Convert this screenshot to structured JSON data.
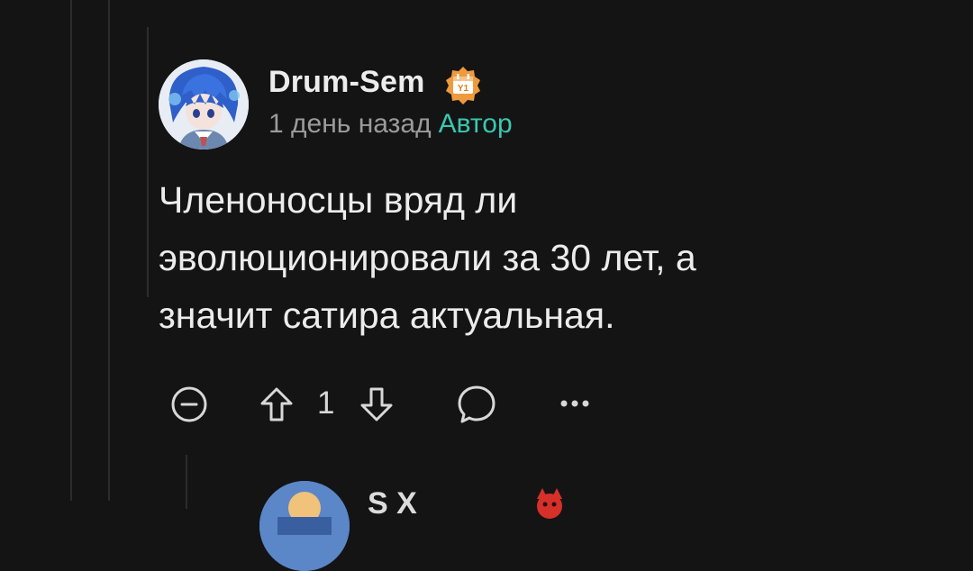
{
  "comment": {
    "author": {
      "name": "Drum-Sem",
      "avatar": "anime-avatar-blue-hair",
      "badge": {
        "icon": "calendar-badge-icon",
        "text": "Y1",
        "color": "#f09a3e"
      }
    },
    "time": "1 день назад",
    "author_tag": "Автор",
    "text_lines": [
      "Членоносцы вряд ли",
      "эволюционировали за 30 лет, а",
      "значит сатира актуальная."
    ],
    "actions": {
      "collapse_icon": "minus-circle-icon",
      "upvote_icon": "arrow-up-icon",
      "vote_count": "1",
      "downvote_icon": "arrow-down-icon",
      "reply_icon": "comment-bubble-icon",
      "more_icon": "more-dots-icon"
    }
  },
  "next_comment": {
    "name_partial": "S     X",
    "badge_icon": "red-devil-badge-icon"
  },
  "colors": {
    "background": "#141414",
    "accent_author": "#39c7b1",
    "muted_text": "#9b9b9b"
  }
}
